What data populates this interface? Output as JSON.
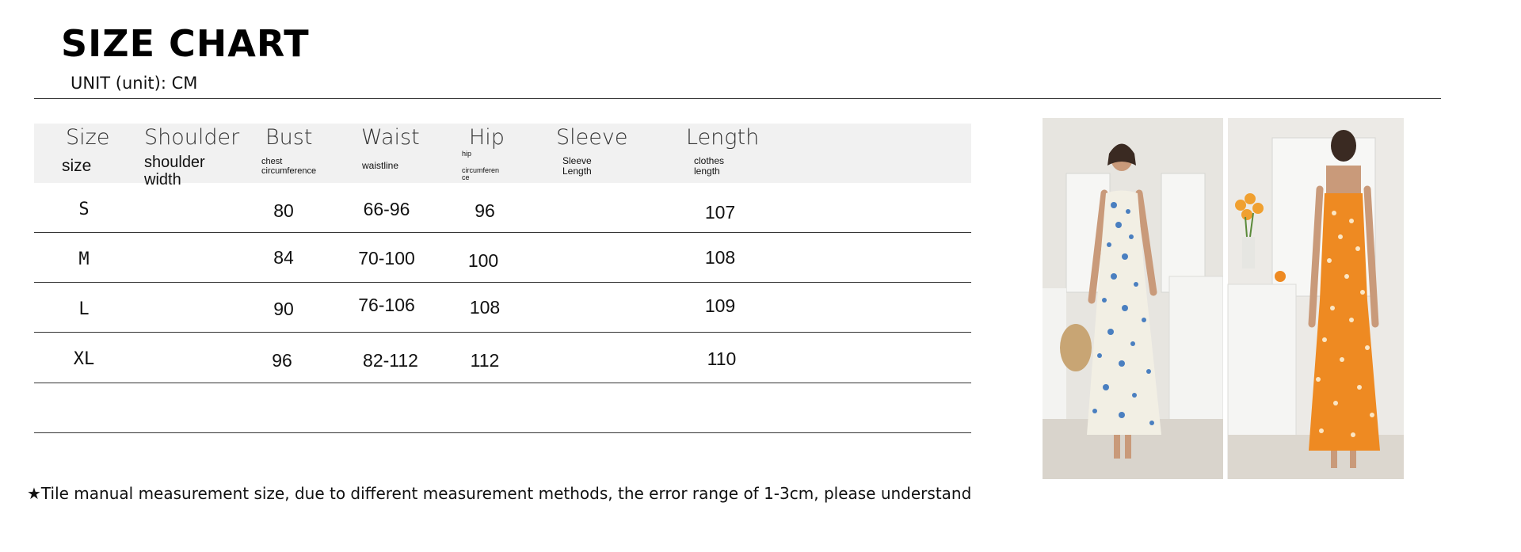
{
  "title": "SIZE CHART",
  "unit": "UNIT (unit): CM",
  "table": {
    "headers": [
      {
        "en": "Size",
        "sub": "size"
      },
      {
        "en": "Shoulder",
        "sub": "shoulder\nwidth"
      },
      {
        "en": "Bust",
        "sub": "chest\ncircumference"
      },
      {
        "en": "Waist",
        "sub": "waistline"
      },
      {
        "en": "Hip",
        "sub_top": "hip",
        "sub": "circumferen\nce"
      },
      {
        "en": "Sleeve",
        "sub": "Sleeve\nLength"
      },
      {
        "en": "Length",
        "sub": "clothes\nlength"
      }
    ],
    "rows": [
      {
        "size": "S",
        "bust": "80",
        "waist": "66-96",
        "hip": "96",
        "length": "107"
      },
      {
        "size": "M",
        "bust": "84",
        "waist": "70-100",
        "hip": "100",
        "length": "108"
      },
      {
        "size": "L",
        "bust": "90",
        "waist": "76-106",
        "hip": "108",
        "length": "109"
      },
      {
        "size": "XL",
        "bust": "96",
        "waist": "82-112",
        "hip": "112",
        "length": "110"
      }
    ]
  },
  "note": "★Tile manual measurement size, due to different measurement methods, the error range of 1-3cm, please understand",
  "photo": {
    "description_icon": "product-photo",
    "dress_front_color": "#f4f2ea",
    "dress_print_color": "#4a7fc0",
    "dress_back_color": "#ee8a22",
    "kitchen_color": "#e9e7e2"
  }
}
